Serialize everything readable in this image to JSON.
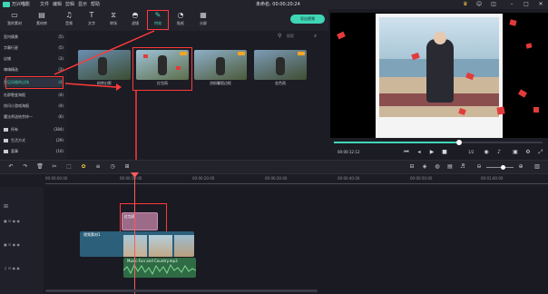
{
  "app": {
    "name": "万兴喵影",
    "menus": [
      "文件",
      "编辑",
      "剪辑",
      "显示",
      "帮助"
    ],
    "doc_title": "未命名: 00:00:20:24",
    "window_controls": [
      "minimize-icon",
      "maximize-icon",
      "close-icon"
    ]
  },
  "toolbar": {
    "tools": [
      {
        "label": "我的素材",
        "icon": "folder-icon"
      },
      {
        "label": "素材库",
        "icon": "library-icon"
      },
      {
        "label": "音频",
        "icon": "music-icon"
      },
      {
        "label": "文字",
        "icon": "text-icon"
      },
      {
        "label": "转场",
        "icon": "transition-icon"
      },
      {
        "label": "滤镜",
        "icon": "filter-icon"
      },
      {
        "label": "特效",
        "icon": "magic-wand-icon"
      },
      {
        "label": "贴纸",
        "icon": "sticker-icon"
      },
      {
        "label": "分屏",
        "icon": "split-screen-icon"
      }
    ],
    "active": "特效",
    "export_label": "导出视频"
  },
  "categories": [
    {
      "label": "室内情景",
      "count": "(5)"
    },
    {
      "label": "字幕行星",
      "count": "(5)"
    },
    {
      "label": "店铺",
      "count": "(3)"
    },
    {
      "label": "嗨嗨精选",
      "count": "(3)"
    },
    {
      "label": "常见风格的过场",
      "count": "(4)"
    },
    {
      "label": "社群裂变海报",
      "count": "(4)"
    },
    {
      "label": "快闪小游戏海报",
      "count": "(4)"
    },
    {
      "label": "魔法师送给余梓一",
      "count": "(6)"
    }
  ],
  "folders": [
    {
      "label": "所有",
      "count": "(384)"
    },
    {
      "label": "生活方式",
      "count": "(29)"
    },
    {
      "label": "喜事",
      "count": "(10)"
    }
  ],
  "search": {
    "placeholder": "搜索"
  },
  "effects": [
    {
      "label": "粉转幻影"
    },
    {
      "label": "红包雨"
    },
    {
      "label": "浓粉暑假边框"
    },
    {
      "label": "金色雨"
    }
  ],
  "preview": {
    "timecode": "00:00:12:12",
    "page": "1/2"
  },
  "ruler": [
    "00:00:00:00",
    "00:00:10:00",
    "00:00:20:00",
    "00:00:30:00",
    "00:00:40:00",
    "00:00:50:00",
    "00:01:00:00"
  ],
  "timeline": {
    "effect_clip": "红包雨",
    "video_clip": "视频素材1",
    "audio_clip": "Music-Fun and Country.mp3"
  },
  "colors": {
    "accent": "#3fd6b6",
    "annotation": "#ff3a3a"
  }
}
